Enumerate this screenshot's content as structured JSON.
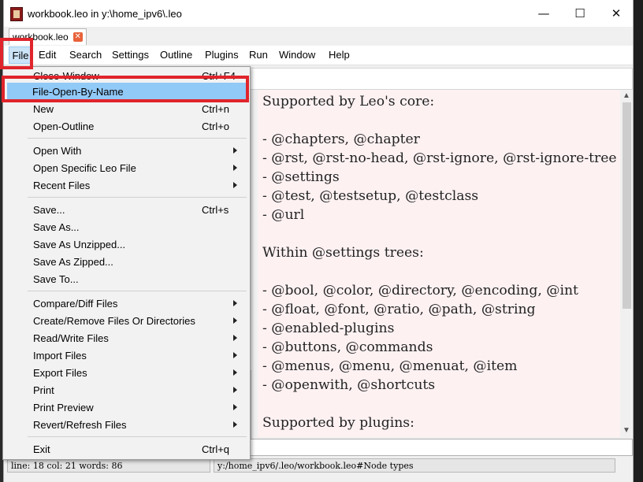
{
  "window": {
    "title": "workbook.leo in y:\\home_ipv6\\.leo",
    "minimize_glyph": "—",
    "maximize_glyph": "☐",
    "close_glyph": "✕"
  },
  "tab": {
    "label": "workbook.leo",
    "close_glyph": "✕"
  },
  "menubar": {
    "items": [
      "File",
      "Edit",
      "Search",
      "Settings",
      "Outline",
      "Plugins",
      "Run",
      "Window",
      "Help"
    ]
  },
  "file_menu": {
    "items": [
      {
        "label": "Close-Window",
        "shortcut": "Ctrl+F4"
      },
      {
        "label": "File-Open-By-Name",
        "shortcut": "",
        "selected": true
      },
      {
        "label": "New",
        "shortcut": "Ctrl+n"
      },
      {
        "label": "Open-Outline",
        "shortcut": "Ctrl+o"
      },
      {
        "label": "Open With",
        "submenu": true
      },
      {
        "label": "Open Specific Leo File",
        "submenu": true
      },
      {
        "label": "Recent Files",
        "submenu": true
      },
      {
        "label": "Save...",
        "shortcut": "Ctrl+s"
      },
      {
        "label": "Save As..."
      },
      {
        "label": "Save As Unzipped..."
      },
      {
        "label": "Save As Zipped..."
      },
      {
        "label": "Save To..."
      },
      {
        "label": "Compare/Diff Files",
        "submenu": true
      },
      {
        "label": "Create/Remove Files Or Directories",
        "submenu": true
      },
      {
        "label": "Read/Write Files",
        "submenu": true
      },
      {
        "label": "Import Files",
        "submenu": true
      },
      {
        "label": "Export Files",
        "submenu": true
      },
      {
        "label": "Print",
        "submenu": true
      },
      {
        "label": "Print Preview",
        "submenu": true
      },
      {
        "label": "Revert/Refresh Files",
        "submenu": true
      },
      {
        "label": "Exit",
        "shortcut": "Ctrl+q"
      }
    ]
  },
  "editor": {
    "lines": [
      "Supported by Leo's core:",
      "",
      "- @chapters, @chapter",
      "- @rst, @rst-no-head, @rst-ignore, @rst-ignore-tree",
      "- @settings",
      "- @test, @testsetup, @testclass",
      "- @url",
      "",
      "Within @settings trees:",
      "",
      "- @bool, @color, @directory, @encoding, @int",
      "- @float, @font, @ratio, @path, @string",
      "- @enabled-plugins",
      "- @buttons, @commands",
      "- @menus, @menu, @menuat, @item",
      "- @openwith, @shortcuts",
      "",
      "Supported by plugins:"
    ]
  },
  "status": {
    "left": "line: 18 col: 21  words: 86",
    "right": "y:/home_ipv6/.leo/workbook.leo#Node types"
  },
  "colors": {
    "editor_bg": "#fdf1f2",
    "highlight_box": "#e0242b",
    "selected_item": "#91c9f7"
  }
}
